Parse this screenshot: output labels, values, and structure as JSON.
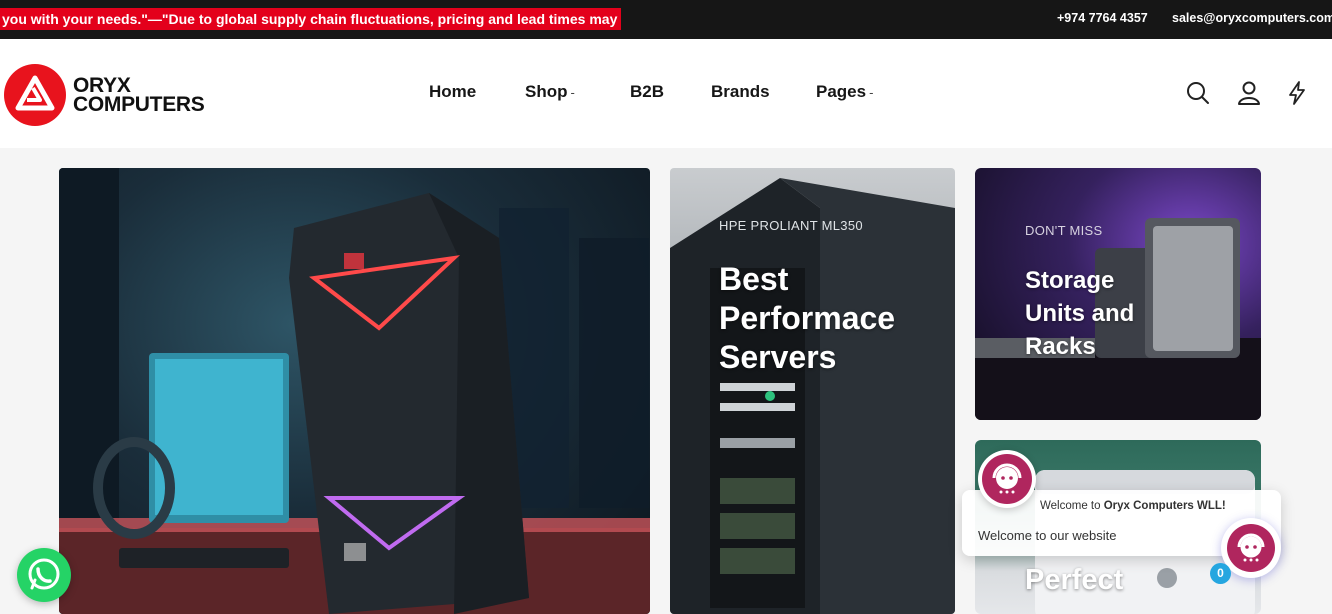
{
  "topbar": {
    "ticker": "you with your needs.\"—\"Due to global supply chain fluctuations, pricing and lead times may",
    "phone": "+974 7764 4357",
    "email": "sales@oryxcomputers.com"
  },
  "brand": {
    "line1": "ORYX",
    "line2": "COMPUTERS",
    "color": "#e8131d"
  },
  "nav": [
    {
      "label": "Home",
      "dropdown": false
    },
    {
      "label": "Shop",
      "dropdown": true
    },
    {
      "label": "B2B",
      "dropdown": false
    },
    {
      "label": "Brands",
      "dropdown": false
    },
    {
      "label": "Pages",
      "dropdown": true
    }
  ],
  "header_icons": [
    "search-icon",
    "user-icon",
    "lightning-icon"
  ],
  "banners": {
    "servers": {
      "subtitle": "HPE PROLIANT ML350",
      "title_lines": [
        "Best",
        "Performace",
        "Servers"
      ]
    },
    "storage": {
      "subtitle": "DON'T MISS",
      "title_lines": [
        "Storage",
        "Units and",
        "Racks"
      ]
    },
    "printers": {
      "title_lines": [
        "Perfect"
      ]
    }
  },
  "chat": {
    "greeting_prefix": "Welcome to ",
    "greeting_company": "Oryx Computers WLL!",
    "message": "Welcome to our website",
    "badge_count": "0"
  }
}
